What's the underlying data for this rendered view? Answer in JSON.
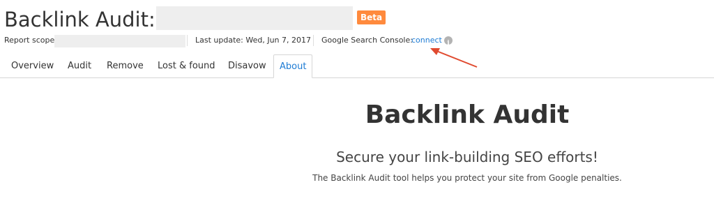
{
  "header": {
    "title": "Backlink Audit:",
    "badge": "Beta"
  },
  "meta": {
    "scope_label": "Report scope",
    "last_update": "Last update: Wed, Jun 7, 2017",
    "gsc_label": "Google Search Console:",
    "connect_label": "connect",
    "info_icon": "info-icon"
  },
  "tabs": [
    {
      "label": "Overview",
      "active": false
    },
    {
      "label": "Audit",
      "active": false
    },
    {
      "label": "Remove",
      "active": false
    },
    {
      "label": "Lost & found",
      "active": false
    },
    {
      "label": "Disavow",
      "active": false
    },
    {
      "label": "About",
      "active": true
    }
  ],
  "main": {
    "title": "Backlink Audit",
    "subtitle": "Secure your link-building SEO efforts!",
    "description": "The Backlink Audit tool helps you protect your site from Google penalties."
  },
  "colors": {
    "accent": "#1d7bd4",
    "badge": "#ff8a3d",
    "arrow": "#e04a2f"
  }
}
